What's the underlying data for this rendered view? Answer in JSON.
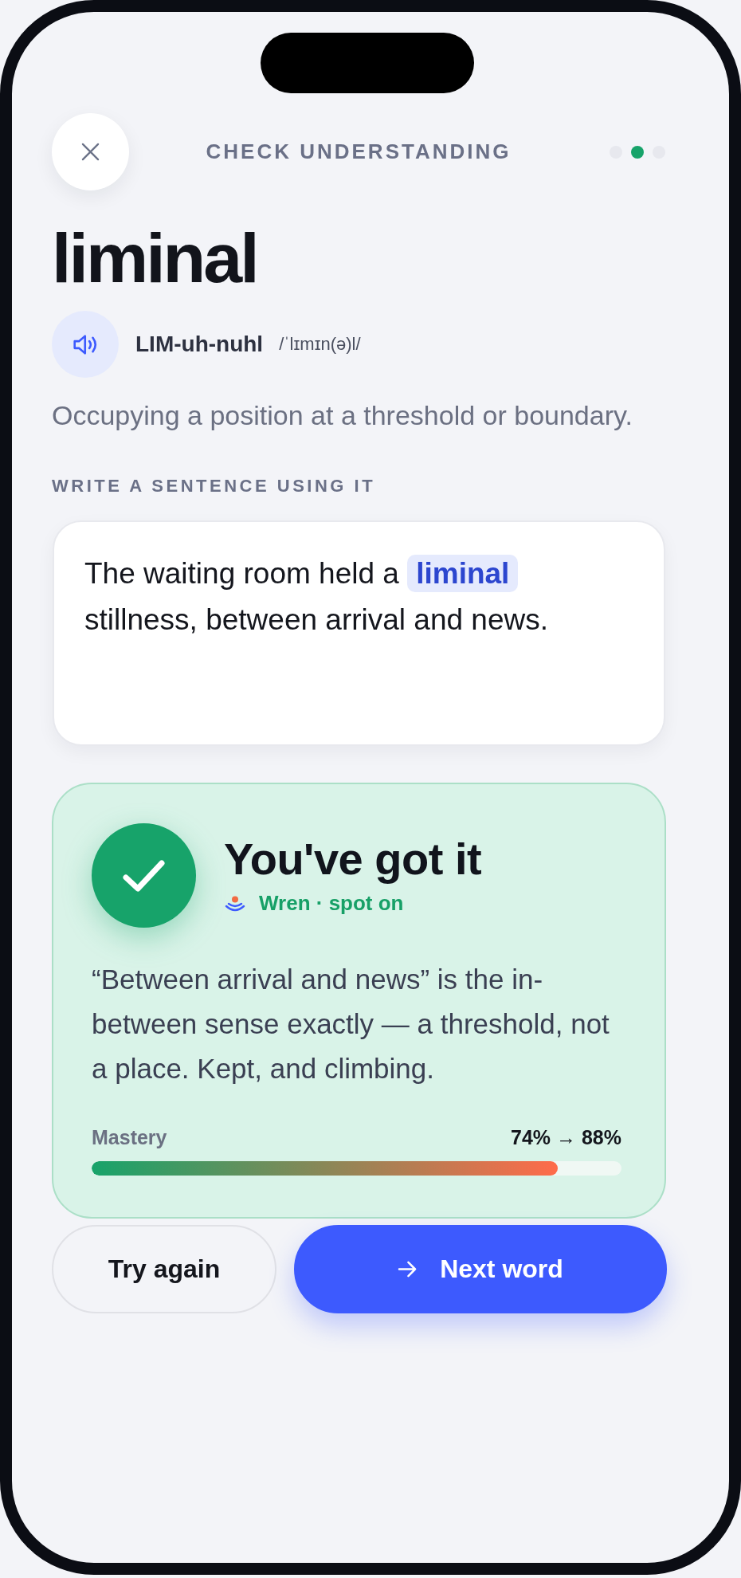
{
  "header": {
    "title": "CHECK UNDERSTANDING",
    "steps": [
      {
        "selected": false
      },
      {
        "selected": true
      },
      {
        "selected": false
      }
    ]
  },
  "word": {
    "headword": "liminal",
    "respelling": "LIM-uh-nuhl",
    "ipa": "/ˈlɪmɪn(ə)l/",
    "definition": "Occupying a position at a threshold or boundary."
  },
  "prompt": {
    "label": "WRITE A SENTENCE USING IT",
    "answer": "The waiting room held a **liminal** stillness, between arrival and news."
  },
  "feedback": {
    "correct": true,
    "title": "You've got it",
    "source": "Wren · spot on",
    "message": "“Between arrival and news” is the in-between sense exactly — a threshold, not a place. Kept, and climbing.",
    "mastery": {
      "label": "Mastery",
      "reading": "74% → 88%",
      "level": 0.88
    }
  },
  "actions": [
    {
      "kind": "secondary",
      "label": "Try again"
    },
    {
      "kind": "primary",
      "label": "Next word"
    }
  ]
}
